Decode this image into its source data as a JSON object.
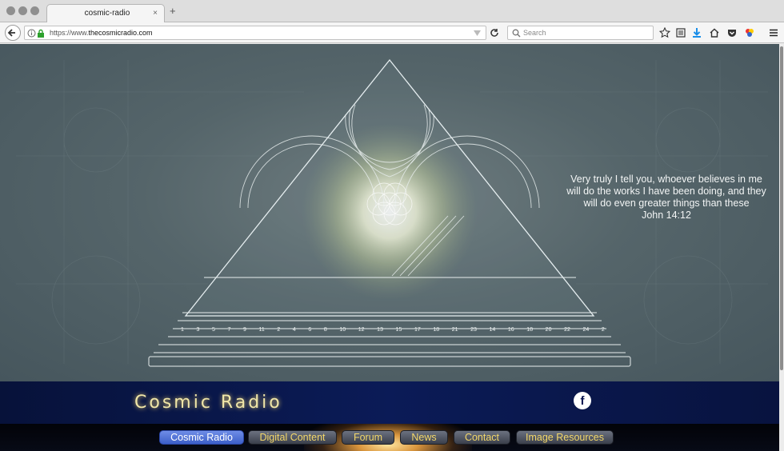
{
  "browser": {
    "tab_title": "cosmic-radio",
    "tab_close": "×",
    "new_tab": "+",
    "url_prefix": "https://www.",
    "url_domain": "thecosmicradio.com",
    "search_placeholder": "Search"
  },
  "hero": {
    "quote_lines": [
      "Very truly I tell you, whoever believes in me",
      "will do the works I have been doing, and they",
      "will do even greater things than these",
      "John 14:12"
    ],
    "ruler_numbers": [
      "1",
      "3",
      "5",
      "7",
      "9",
      "11",
      "2",
      "4",
      "6",
      "8",
      "10",
      "12",
      "13",
      "15",
      "17",
      "18",
      "21",
      "23",
      "14",
      "16",
      "18",
      "20",
      "22",
      "24",
      "2"
    ]
  },
  "banner": {
    "site_title": "Cosmic Radio",
    "facebook_glyph": "f"
  },
  "nav": {
    "items": [
      {
        "label": "Cosmic Radio",
        "active": true
      },
      {
        "label": "Digital Content",
        "active": false
      },
      {
        "label": "Forum",
        "active": false
      },
      {
        "label": "News",
        "active": false
      },
      {
        "label": "Contact",
        "active": false
      },
      {
        "label": "Image Resources",
        "active": false
      }
    ]
  },
  "colors": {
    "banner_bg": "#0b1b57",
    "title_gold": "#f0e6a8",
    "nav_text": "#f4d86a",
    "nav_active": "#3c5fc9"
  }
}
